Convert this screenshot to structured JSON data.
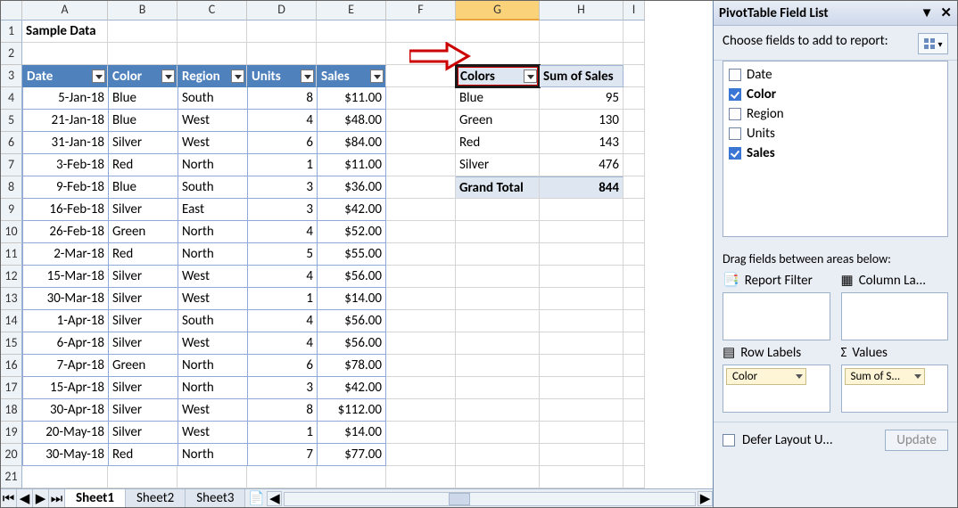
{
  "columns": [
    "A",
    "B",
    "C",
    "D",
    "E",
    "F",
    "G",
    "H",
    "I"
  ],
  "selected_column_index": 6,
  "title_cell": "Sample Data",
  "table": {
    "headers": [
      "Date",
      "Color",
      "Region",
      "Units",
      "Sales"
    ],
    "rows": [
      {
        "date": "5-Jan-18",
        "color": "Blue",
        "region": "South",
        "units": 8,
        "sales": "$11.00"
      },
      {
        "date": "21-Jan-18",
        "color": "Blue",
        "region": "West",
        "units": 4,
        "sales": "$48.00"
      },
      {
        "date": "31-Jan-18",
        "color": "Silver",
        "region": "West",
        "units": 6,
        "sales": "$84.00"
      },
      {
        "date": "3-Feb-18",
        "color": "Red",
        "region": "North",
        "units": 1,
        "sales": "$11.00"
      },
      {
        "date": "9-Feb-18",
        "color": "Blue",
        "region": "South",
        "units": 3,
        "sales": "$36.00"
      },
      {
        "date": "16-Feb-18",
        "color": "Silver",
        "region": "East",
        "units": 3,
        "sales": "$42.00"
      },
      {
        "date": "26-Feb-18",
        "color": "Green",
        "region": "North",
        "units": 4,
        "sales": "$52.00"
      },
      {
        "date": "2-Mar-18",
        "color": "Red",
        "region": "North",
        "units": 5,
        "sales": "$55.00"
      },
      {
        "date": "15-Mar-18",
        "color": "Silver",
        "region": "West",
        "units": 4,
        "sales": "$56.00"
      },
      {
        "date": "30-Mar-18",
        "color": "Silver",
        "region": "West",
        "units": 1,
        "sales": "$14.00"
      },
      {
        "date": "1-Apr-18",
        "color": "Silver",
        "region": "South",
        "units": 4,
        "sales": "$56.00"
      },
      {
        "date": "6-Apr-18",
        "color": "Silver",
        "region": "West",
        "units": 4,
        "sales": "$56.00"
      },
      {
        "date": "7-Apr-18",
        "color": "Green",
        "region": "North",
        "units": 6,
        "sales": "$78.00"
      },
      {
        "date": "15-Apr-18",
        "color": "Silver",
        "region": "North",
        "units": 3,
        "sales": "$42.00"
      },
      {
        "date": "30-Apr-18",
        "color": "Silver",
        "region": "West",
        "units": 8,
        "sales": "$112.00"
      },
      {
        "date": "20-May-18",
        "color": "Silver",
        "region": "West",
        "units": 1,
        "sales": "$14.00"
      },
      {
        "date": "30-May-18",
        "color": "Red",
        "region": "North",
        "units": 7,
        "sales": "$77.00"
      }
    ]
  },
  "pivot": {
    "row_header": "Colors",
    "val_header": "Sum of Sales",
    "rows": [
      {
        "label": "Blue",
        "value": 95
      },
      {
        "label": "Green",
        "value": 130
      },
      {
        "label": "Red",
        "value": 143
      },
      {
        "label": "Silver",
        "value": 476
      }
    ],
    "total_label": "Grand Total",
    "total_value": 844
  },
  "sheets": {
    "tabs": [
      "Sheet1",
      "Sheet2",
      "Sheet3"
    ],
    "active": 0
  },
  "fieldlist": {
    "title": "PivotTable Field List",
    "prompt": "Choose fields to add to report:",
    "fields": [
      {
        "name": "Date",
        "checked": false
      },
      {
        "name": "Color",
        "checked": true
      },
      {
        "name": "Region",
        "checked": false
      },
      {
        "name": "Units",
        "checked": false
      },
      {
        "name": "Sales",
        "checked": true
      }
    ],
    "drag_label": "Drag fields between areas below:",
    "areas": {
      "report_filter": "Report Filter",
      "column_labels": "Column La...",
      "row_labels": "Row Labels",
      "values": "Values",
      "row_pill": "Color",
      "values_pill": "Sum of S..."
    },
    "defer": "Defer Layout U...",
    "update": "Update"
  }
}
